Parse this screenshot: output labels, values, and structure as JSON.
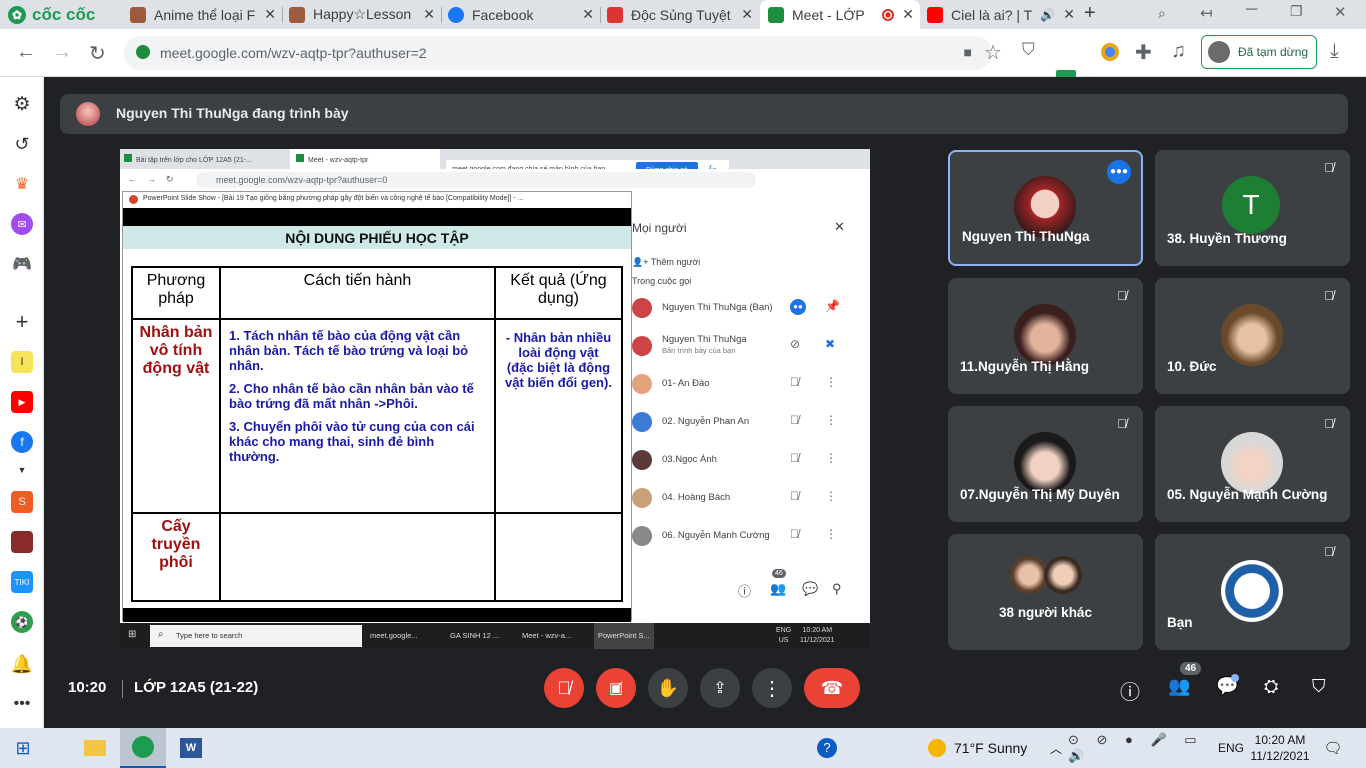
{
  "browser": {
    "brand": "cốc cốc",
    "tabs": [
      {
        "title": "Anime thể loại F",
        "color": "#9c5b3c"
      },
      {
        "title": "Happy☆Lesson",
        "color": "#9c5b3c"
      },
      {
        "title": "Facebook",
        "color": "#1877f2"
      },
      {
        "title": "Độc Sủng Tuyệt",
        "color": "#d33"
      },
      {
        "title": "Meet - LỚP",
        "color": "#1e8e3e"
      },
      {
        "title": "Ciel là ai? | T",
        "color": "#ff0000"
      }
    ],
    "url": "meet.google.com/wzv-aqtp-tpr?authuser=2",
    "paused_label": "Đã tạm dừng"
  },
  "meet": {
    "presenting_banner": "Nguyen Thi ThuNga đang trình bày",
    "time": "10:20",
    "meeting_name": "LỚP 12A5 (21-22)",
    "people_count": "46",
    "tiles": [
      {
        "name": "Nguyen Thi ThuNga",
        "active": true
      },
      {
        "name": "38. Huyền Thương",
        "letter": "T"
      },
      {
        "name": "11.Nguyễn Thị Hằng"
      },
      {
        "name": "10. Đức"
      },
      {
        "name": "07.Nguyễn Thị Mỹ Duyên"
      },
      {
        "name": "05. Nguyễn Mạnh Cường"
      },
      {
        "name": "38 người khác"
      },
      {
        "name": "Bạn"
      }
    ]
  },
  "shared": {
    "inner_tabs": [
      "Bài tập trên lớp cho LỚP 12A5 (21-...",
      "Meet - wzv-aqtp-tpr"
    ],
    "share_notice": "meet.google.com đang chia sẻ màn hình của bạn.",
    "stop_share_label": "Dừng chia sẻ",
    "hide_label": "Ẩn",
    "inner_url": "meet.google.com/wzv-aqtp-tpr?authuser=0",
    "ppt_title": "PowerPoint Slide Show - [Bài 19 Tạo giống bằng phương pháp gây đột biến và công nghệ tế bào [Compatibility Mode]] - ...",
    "slide_title": "NỘI DUNG PHIẾU HỌC TẬP",
    "col_headers": [
      "Phương pháp",
      "Cách tiến hành",
      "Kết quả (Ứng dụng)"
    ],
    "row1_method": "Nhân bản vô tính động vật",
    "row1_steps": [
      "1. Tách nhân tế bào của động vật cần nhân bản. Tách tế bào trứng và loại bỏ nhân.",
      "2. Cho nhân tế bào cần nhân bản vào tế bào trứng đã mất nhân ->Phôi.",
      "3. Chuyển phôi vào tử cung của con cái khác cho mang thai, sinh đẻ bình thường."
    ],
    "row1_result": "- Nhân bản nhiều loài động vật (đặc biệt là động vật biến đổi gen).",
    "row2_method": "Cấy truyền phôi",
    "people_panel_title": "Mọi người",
    "add_people": "Thêm người",
    "in_call": "Trong cuộc gọi",
    "participants": [
      {
        "name": "Nguyen Thi ThuNga (Bạn)"
      },
      {
        "name": "Nguyen Thi ThuNga",
        "sub": "Bản trình bày của bạn"
      },
      {
        "name": "01- An Đào"
      },
      {
        "name": "02. Nguyễn Phan An"
      },
      {
        "name": "03.Ngọc Ánh"
      },
      {
        "name": "04. Hoàng Bách"
      },
      {
        "name": "06. Nguyễn Mạnh Cường"
      }
    ],
    "inner_count": "46",
    "inner_taskbar": {
      "search": "Type here to search",
      "apps": [
        "meet.google...",
        "GA SINH 12 ...",
        "Meet - wzv-a...",
        "PowerPoint S..."
      ],
      "lang": "ENG",
      "region": "US",
      "time": "10:20 AM",
      "date": "11/12/2021"
    }
  },
  "taskbar": {
    "weather": "71°F  Sunny",
    "lang": "ENG",
    "time": "10:20 AM",
    "date": "11/12/2021"
  }
}
